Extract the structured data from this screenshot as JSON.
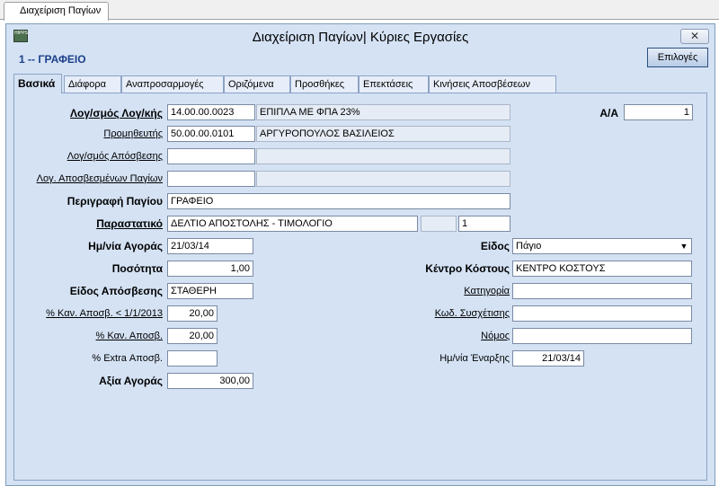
{
  "app_tab": "Διαχείριση Παγίων",
  "window": {
    "title": "Διαχείριση Παγίων| Κύριες Εργασίες",
    "icon_text": "HIPPS",
    "close": "✕"
  },
  "record_title": "1 -- ΓΡΑΦΕΙΟ",
  "options_button": "Επιλογές",
  "tabs": [
    "Βασικά",
    "Διάφορα",
    "Αναπροσαρμογές",
    "Οριζόμενα",
    "Προσθήκες",
    "Επεκτάσεις",
    "Κινήσεις Αποσβέσεων"
  ],
  "form": {
    "account": {
      "label": "Λογ/σμός Λογ/κής",
      "code": "14.00.00.0023",
      "desc": "ΕΠΙΠΛΑ ΜΕ ΦΠΑ 23%"
    },
    "aa": {
      "label": "Α/Α",
      "value": "1"
    },
    "supplier": {
      "label": "Προμηθευτής",
      "code": "50.00.00.0101",
      "desc": "ΑΡΓΥΡΟΠΟΥΛΟΣ ΒΑΣΙΛΕΙΟΣ"
    },
    "depr_account": {
      "label": "Λογ/σμός Απόσβεσης",
      "code": "",
      "desc": ""
    },
    "depr_assets_account": {
      "label": "Λογ. Αποσβεσμένων Παγίων",
      "code": "",
      "desc": ""
    },
    "description": {
      "label": "Περιγραφή Παγίου",
      "value": "ΓΡΑΦΕΙΟ"
    },
    "document": {
      "label": "Παραστατικό",
      "type": "ΔΕΛΤΙΟ ΑΠΟΣΤΟΛΗΣ - ΤΙΜΟΛΟΓΙΟ",
      "series": "",
      "number": "1"
    },
    "purchase_date": {
      "label": "Ημ/νία Αγοράς",
      "value": "21/03/14"
    },
    "kind": {
      "label": "Είδος",
      "value": "Πάγιο",
      "arrow": "▼"
    },
    "quantity": {
      "label": "Ποσότητα",
      "value": "1,00"
    },
    "cost_center": {
      "label": "Κέντρο Κόστους",
      "value": "ΚΕΝΤΡΟ ΚΟΣΤΟΥΣ"
    },
    "depr_type": {
      "label": "Είδος Απόσβεσης",
      "value": "ΣΤΑΘΕΡΗ"
    },
    "category": {
      "label": "Κατηγορία",
      "value": ""
    },
    "rate_before": {
      "label": "% Καν. Αποσβ. < 1/1/2013",
      "value": "20,00"
    },
    "relation_code": {
      "label": "Κωδ. Συσχέτισης",
      "value": ""
    },
    "rate": {
      "label": "% Καν. Αποσβ.",
      "value": "20,00"
    },
    "law": {
      "label": "Νόμος",
      "value": ""
    },
    "rate_extra": {
      "label": "% Extra Αποσβ.",
      "value": ""
    },
    "start_date": {
      "label": "Ημ/νία Έναρξης",
      "value": "21/03/14"
    },
    "purchase_value": {
      "label": "Αξία Αγοράς",
      "value": "300,00"
    }
  }
}
